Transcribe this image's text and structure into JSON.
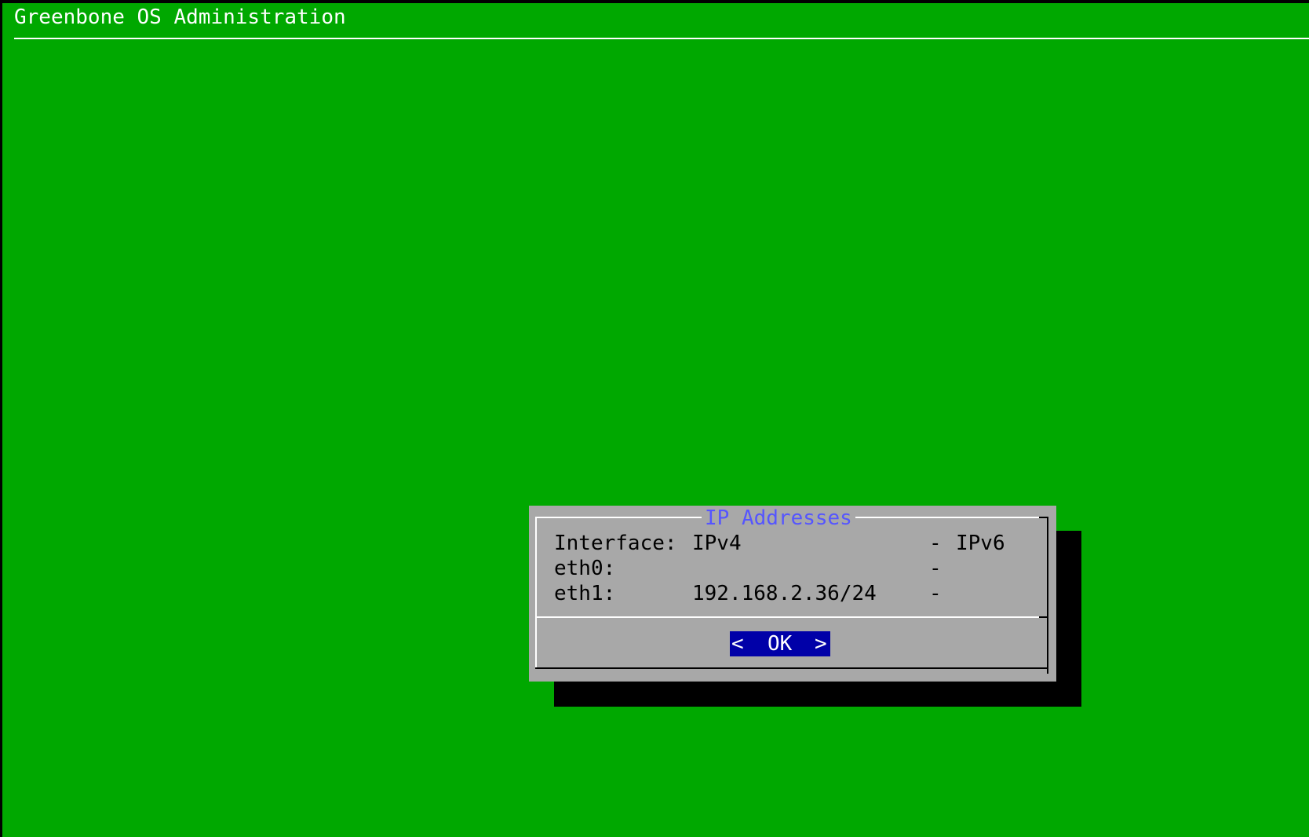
{
  "backtitle": "Greenbone OS Administration",
  "dialog": {
    "title": "IP Addresses",
    "header": {
      "interface": "Interface:",
      "ipv4": "IPv4",
      "separator": "-",
      "ipv6": "IPv6"
    },
    "rows": [
      {
        "interface": "eth0:",
        "ipv4": "",
        "separator": "-",
        "ipv6": ""
      },
      {
        "interface": "eth1:",
        "ipv4": "192.168.2.36/24",
        "separator": "-",
        "ipv6": ""
      }
    ],
    "ok_button": {
      "left_arrow": "<",
      "label": "OK",
      "right_arrow": ">"
    }
  },
  "colors": {
    "background": "#00a800",
    "dialog": "#a8a8a8",
    "title": "#5555ff",
    "button": "#0000a8",
    "shadow": "#000000"
  }
}
